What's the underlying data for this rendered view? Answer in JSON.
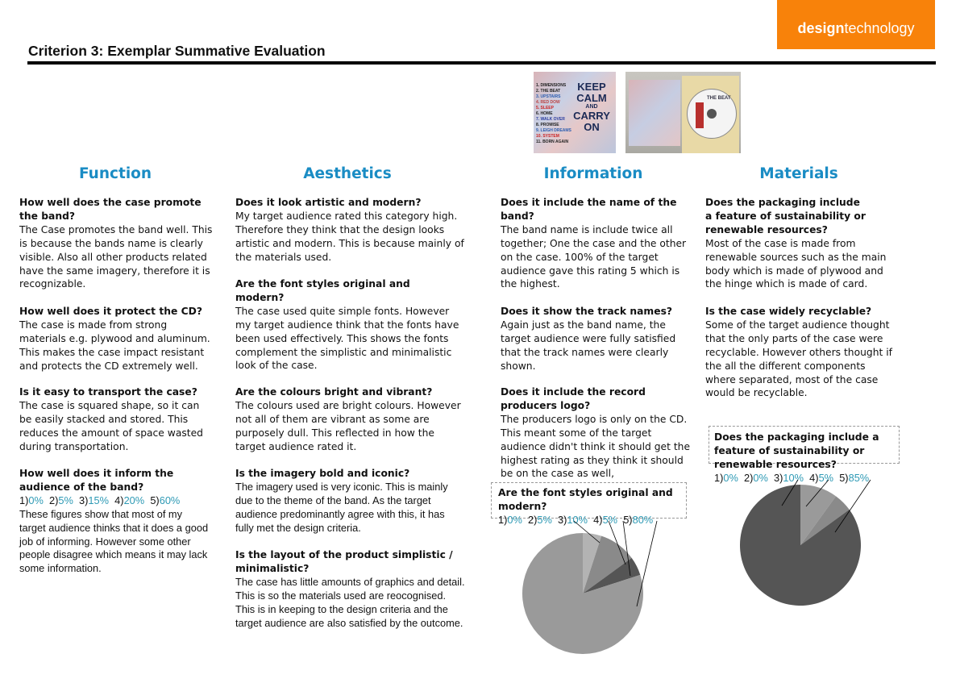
{
  "brand": {
    "bold": "design",
    "light": "technology",
    "color": "#f8820a"
  },
  "page_title": "Criterion 3: Exemplar Summative Evaluation",
  "images": [
    {
      "alt_text": [
        "KEEP",
        "CALM",
        "AND",
        "CARRY",
        "ON"
      ],
      "tracks": [
        "1. DIMENSIONS",
        "2. THE BEAT",
        "3. UPSTAIRS",
        "4. RED DOW",
        "5. SLEEP",
        "6. HOME",
        "7. WALK OVER",
        "8. PROMISE",
        "9. LEIGH DREAMS",
        "10. SYSTEM",
        "11. BORN AGAIN"
      ]
    },
    {
      "disc_label": "THE BEAT"
    }
  ],
  "accent_color": "#1a8cc4",
  "percent_color": "#2e9ab5",
  "columns": [
    {
      "heading": "Function",
      "blocks": [
        {
          "q": "How well does the case promote the band?",
          "a": "The Case promotes the band well. This is because the bands name is clearly visible. Also all other products related have the same imagery, therefore it is recognizable."
        },
        {
          "q": "How well does it protect the CD?",
          "a": "The case is made from strong materials e.g. plywood and aluminum. This makes the case impact resistant and protects the CD extremely well."
        },
        {
          "q": "Is it easy to transport the case?",
          "a": "The case is squared shape, so it can be easily stacked and stored. This reduces the amount of space wasted during transportation."
        },
        {
          "q": "How well does it inform the audience of the band?",
          "ratings": [
            {
              "n": "1)",
              "p": "0%"
            },
            {
              "n": "2)",
              "p": "5%"
            },
            {
              "n": "3)",
              "p": "15%"
            },
            {
              "n": "4)",
              "p": "20%"
            },
            {
              "n": "5)",
              "p": "60%"
            }
          ],
          "a": "These figures show that most of my target audience thinks that it does a good job of informing. However some other people disagree which means it may lack some information."
        }
      ]
    },
    {
      "heading": "Aesthetics",
      "blocks": [
        {
          "q": "Does it look artistic and modern?",
          "a": "My target audience rated this category high. Therefore they think that the design looks artistic and modern. This is because mainly of the materials used."
        },
        {
          "q": "Are the font styles original and modern?",
          "a": "The case used quite simple fonts. However my target audience think that the fonts have been used effectively. This shows the fonts complement the simplistic and minimalistic look of the case."
        },
        {
          "q": "Are the colours bright and vibrant?",
          "a": "The colours used are bright colours. However not all of them are vibrant as some are purposely dull. This reflected in how the target audience rated it."
        },
        {
          "q": "Is the imagery bold and iconic?",
          "a": "The imagery used is very iconic. This is mainly due to the theme of the band. As the target audience predominantly agree with this, it has fully met the design criteria."
        },
        {
          "q": "Is the layout of the product simplistic / minimalistic?",
          "a": "The case has little amounts of graphics and detail. This is so the materials used are reocognised. This is in keeping  to the design criteria and the target audience are also satisfied by the outcome."
        }
      ]
    },
    {
      "heading": "Information",
      "blocks": [
        {
          "q": "Does it include the name of the band?",
          "a": "The band name is include twice  all together; One the case and the other on the case. 100% of the target audience gave this rating 5 which is the highest."
        },
        {
          "q": "Does it show the track names?",
          "a": "Again just as the band name, the target audience were fully satisfied that the track names were clearly shown."
        },
        {
          "q": "Does it include the record producers logo?",
          "a": "The producers logo is only on the CD. This meant some of the target audience didn't think it should get the highest rating as they think it should be on the case as well,"
        }
      ]
    },
    {
      "heading": "Materials",
      "blocks": [
        {
          "q": "Does the packaging include a feature of sustainability or renewable resources?",
          "a": "Most of the case is made from renewable sources such as the main body which is made of plywood and the hinge which is made of card."
        },
        {
          "q": "Is the case widely recyclable?",
          "a": "Some of the target audience thought that the only parts of the case were recyclable. However others thought if the all the different components where separated, most of the case would be recyclable."
        }
      ]
    }
  ],
  "chart_data": [
    {
      "type": "pie",
      "title": "Are the font styles original and modern?",
      "labels": [
        "1)",
        "2)",
        "3)",
        "4)",
        "5)"
      ],
      "values": [
        0,
        5,
        10,
        5,
        80
      ],
      "value_labels": [
        "0%",
        "5%",
        "10%",
        "5%",
        "80%"
      ],
      "colors": [
        "#bdbdbd",
        "#b3b3b3",
        "#8a8a8a",
        "#555555",
        "#9a9a9a"
      ]
    },
    {
      "type": "pie",
      "title": "Does the packaging include a feature of sustainability or renewable resources?",
      "labels": [
        "1)",
        "2)",
        "3)",
        "4)",
        "5)"
      ],
      "values": [
        0,
        0,
        10,
        5,
        85
      ],
      "value_labels": [
        "0%",
        "0%",
        "10%",
        "5%",
        "85%"
      ],
      "colors": [
        "#bdbdbd",
        "#bdbdbd",
        "#9a9a9a",
        "#8a8a8a",
        "#555555"
      ]
    }
  ]
}
